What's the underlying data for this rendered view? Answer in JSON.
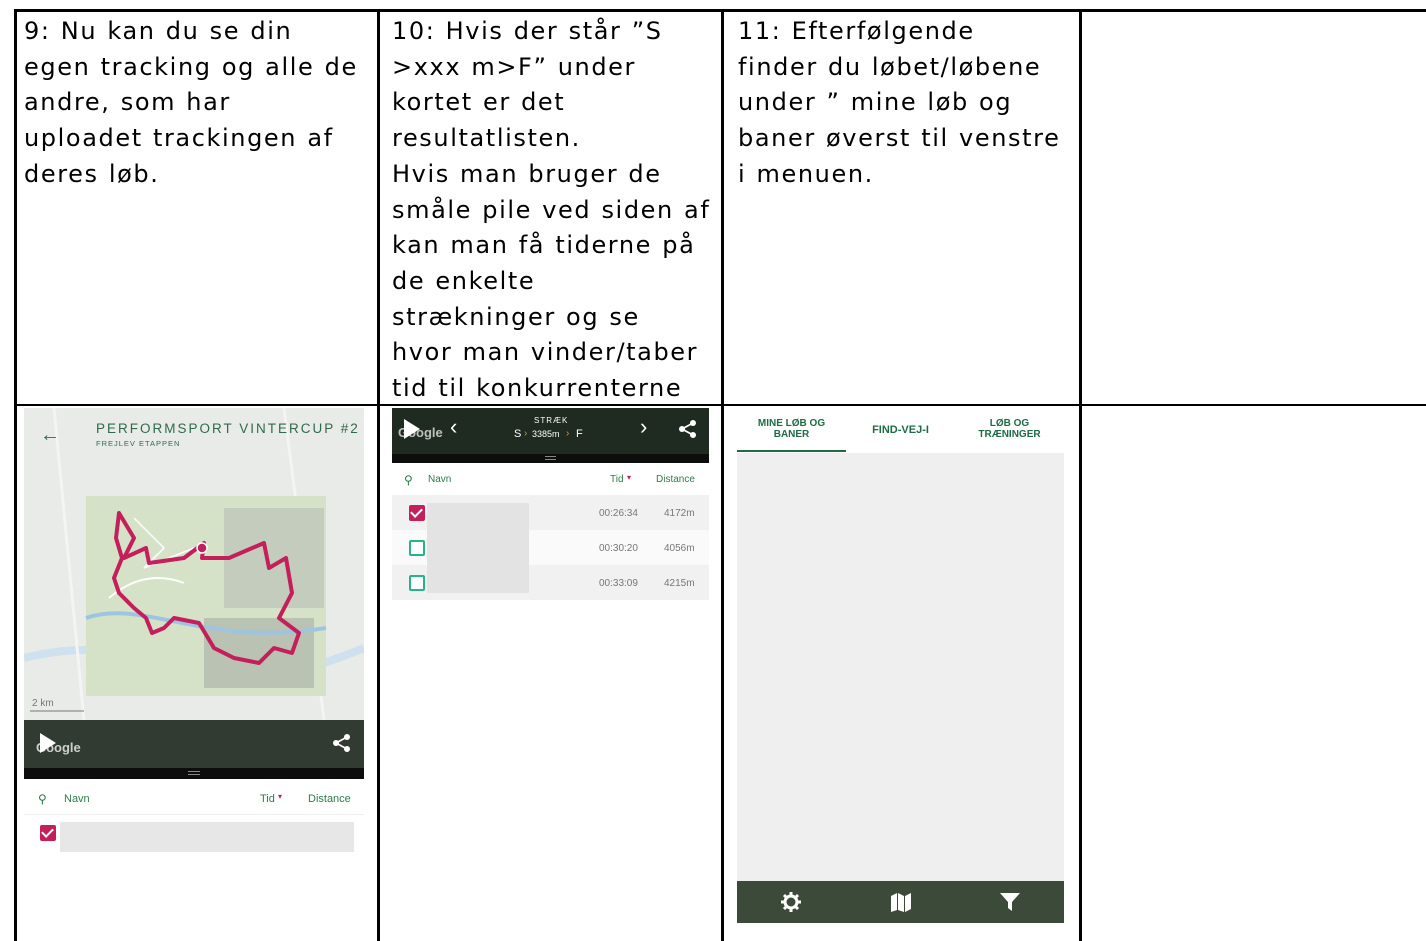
{
  "cells": {
    "c9": [
      "9: Nu kan du se din",
      "egen tracking og alle de",
      "andre, som har",
      "uploadet trackingen af",
      "deres løb."
    ],
    "c10": [
      "10: Hvis der står ”S",
      ">xxx m>F” under",
      "kortet er det",
      "resultatlisten.",
      "Hvis man bruger de",
      "småle pile ved siden af",
      "kan man få tiderne på",
      "de enkelte",
      "strækninger og se",
      "hvor man vinder/taber",
      "tid til konkurrenterne"
    ],
    "c11": [
      "11: Efterfølgende",
      "finder du løbet/løbene",
      "under ” mine løb og",
      "baner øverst til venstre",
      "i menuen."
    ]
  },
  "phone1": {
    "title": "PERFORMSPORT VINTERCUP #2",
    "subtitle": "FREJLEV ETAPPEN",
    "scale": "2 km",
    "google": "Google",
    "col_name": "Navn",
    "col_time": "Tid",
    "col_distance": "Distance"
  },
  "phone2": {
    "strak_label": "STRÆK",
    "strak_s": "S",
    "strak_dist": "3385m",
    "strak_f": "F",
    "col_name": "Navn",
    "col_time": "Tid",
    "col_distance": "Distance",
    "rows": [
      {
        "time": "00:26:34",
        "distance": "4172m",
        "checked": true
      },
      {
        "time": "00:30:20",
        "distance": "4056m",
        "checked": false
      },
      {
        "time": "00:33:09",
        "distance": "4215m",
        "checked": false
      }
    ]
  },
  "phone3": {
    "tabs": [
      {
        "label": "MINE LØB OG BANER",
        "line1": "MINE LØB OG",
        "line2": "BANER"
      },
      {
        "label": "FIND-VEJ-I",
        "line1": "FIND-VEJ-I",
        "line2": ""
      },
      {
        "label": "LØB OG TRÆNINGER",
        "line1": "LØB OG",
        "line2": "TRÆNINGER"
      }
    ],
    "bottom_icons": [
      "gear-icon",
      "map-icon",
      "filter-icon"
    ]
  },
  "colors": {
    "brand_green": "#1e6b46",
    "track_magenta": "#c41e5b",
    "checkbox_teal": "#27b38c",
    "dark_bar": "#1f2a20",
    "bottom_nav": "#3c4a3a"
  }
}
